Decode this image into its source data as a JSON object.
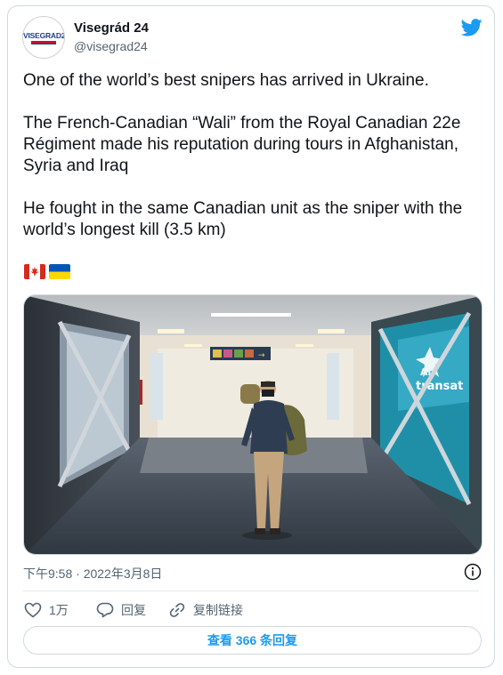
{
  "tweet": {
    "avatar_text": "VISEGRAD24",
    "display_name": "Visegrád 24",
    "handle": "@visegrad24",
    "paragraphs": [
      "One of the world’s best snipers has arrived in Ukraine.",
      "The French-Canadian “Wali” from the Royal Canadian 22e Régiment made his reputation during tours in Afghanistan, Syria and Iraq",
      "He fought in the same Canadian unit as the sniper with the world’s longest kill (3.5 km)"
    ],
    "flags": [
      "canada-flag",
      "ukraine-flag"
    ],
    "photo": {
      "signs": [
        "Air",
        "transat"
      ]
    },
    "timestamp": "下午9:58 · 2022年3月8日"
  },
  "actions": {
    "like_count": "1万",
    "reply_label": "回复",
    "copy_link_label": "复制链接"
  },
  "footer": {
    "view_replies_label": "查看 366 条回复"
  },
  "colors": {
    "twitter_blue": "#1d9bf0",
    "secondary_text": "#536471",
    "border": "#cfd9de"
  }
}
